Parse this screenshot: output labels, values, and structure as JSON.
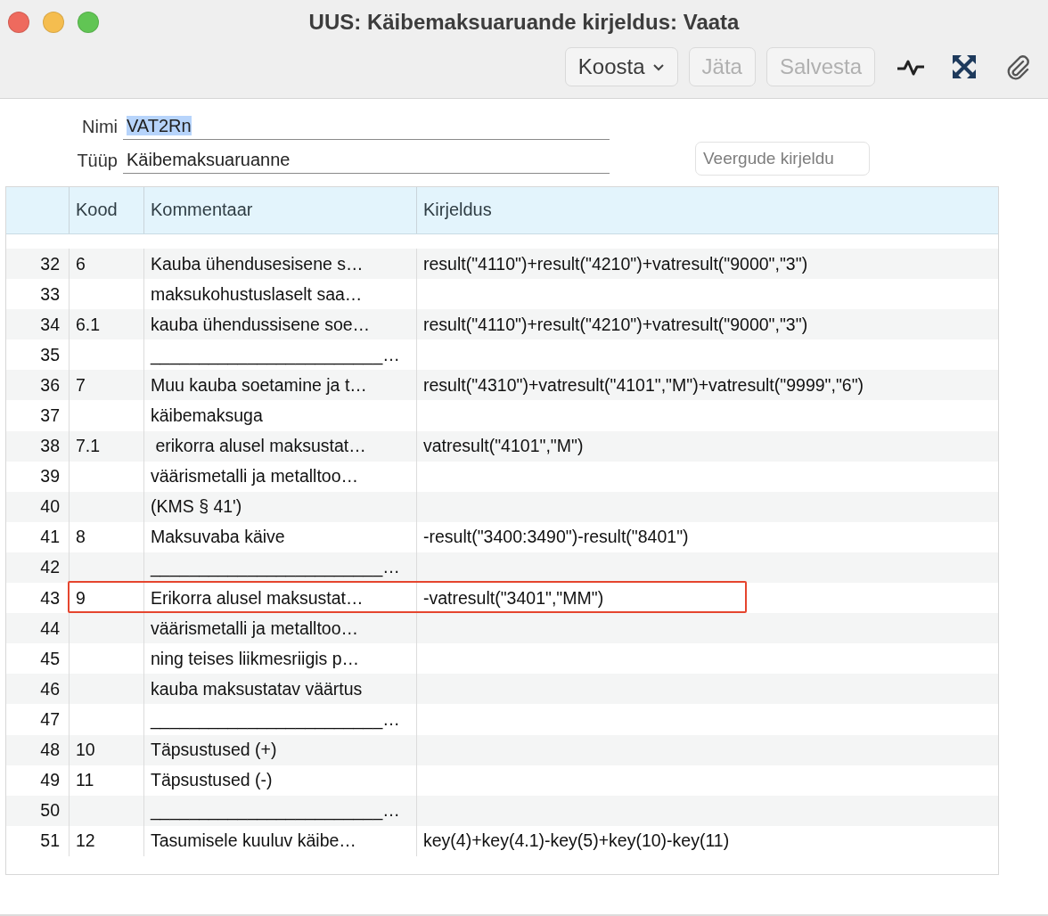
{
  "window": {
    "title": "UUS: Käibemaksuaruande kirjeldus: Vaata"
  },
  "toolbar": {
    "buttons": [
      {
        "label": "Koosta",
        "kind": "dropdown",
        "disabled": false
      },
      {
        "label": "Jäta",
        "kind": "plain",
        "disabled": true
      },
      {
        "label": "Salvesta",
        "kind": "plain",
        "disabled": true
      }
    ]
  },
  "form": {
    "fields": [
      {
        "label": "Nimi",
        "value": "VAT2Rn",
        "selected": true
      },
      {
        "label": "Tüüp",
        "value": "Käibemaksuaruanne",
        "selected": false
      }
    ],
    "side_button": {
      "label": "Veergude kirjeldu"
    }
  },
  "table": {
    "columns": [
      "",
      "Kood",
      "Kommentaar",
      "Kirjeldus"
    ],
    "rows": [
      {
        "n": "32",
        "kood": "6",
        "comment": "Kauba ühendusesisene s…",
        "formula": "result(\"4110\")+result(\"4210\")+vatresult(\"9000\",\"3\")",
        "highlighted": false
      },
      {
        "n": "33",
        "kood": "",
        "comment": "maksukohustuslaselt saa…",
        "formula": "",
        "highlighted": false
      },
      {
        "n": "34",
        "kood": "6.1",
        "comment": "kauba ühendussisene soe…",
        "formula": "result(\"4110\")+result(\"4210\")+vatresult(\"9000\",\"3\")",
        "highlighted": false
      },
      {
        "n": "35",
        "kood": "",
        "comment": "________________________…",
        "formula": "",
        "highlighted": false
      },
      {
        "n": "36",
        "kood": "7",
        "comment": "Muu kauba soetamine ja t…",
        "formula": "result(\"4310\")+vatresult(\"4101\",\"M\")+vatresult(\"9999\",\"6\")",
        "highlighted": false
      },
      {
        "n": "37",
        "kood": "",
        "comment": "käibemaksuga",
        "formula": "",
        "highlighted": false
      },
      {
        "n": "38",
        "kood": "7.1",
        "comment": " erikorra alusel maksustat…",
        "formula": "vatresult(\"4101\",\"M\")",
        "highlighted": false
      },
      {
        "n": "39",
        "kood": "",
        "comment": "väärismetalli ja metalltoo…",
        "formula": "",
        "highlighted": false
      },
      {
        "n": "40",
        "kood": "",
        "comment": "(KMS § 41')",
        "formula": "",
        "highlighted": false
      },
      {
        "n": "41",
        "kood": "8",
        "comment": "Maksuvaba käive",
        "formula": "-result(\"3400:3490\")-result(\"8401\")",
        "highlighted": false
      },
      {
        "n": "42",
        "kood": "",
        "comment": "________________________…",
        "formula": "",
        "highlighted": false
      },
      {
        "n": "43",
        "kood": "9",
        "comment": "Erikorra alusel maksustat…",
        "formula": "-vatresult(\"3401\",\"MM\")",
        "highlighted": true
      },
      {
        "n": "44",
        "kood": "",
        "comment": "väärismetalli ja metalltoo…",
        "formula": "",
        "highlighted": false
      },
      {
        "n": "45",
        "kood": "",
        "comment": "ning teises liikmesriigis p…",
        "formula": "",
        "highlighted": false
      },
      {
        "n": "46",
        "kood": "",
        "comment": "kauba maksustatav väärtus",
        "formula": "",
        "highlighted": false
      },
      {
        "n": "47",
        "kood": "",
        "comment": "________________________…",
        "formula": "",
        "highlighted": false
      },
      {
        "n": "48",
        "kood": "10",
        "comment": "Täpsustused (+)",
        "formula": "",
        "highlighted": false
      },
      {
        "n": "49",
        "kood": "11",
        "comment": "Täpsustused (-)",
        "formula": "",
        "highlighted": false
      },
      {
        "n": "50",
        "kood": "",
        "comment": "________________________…",
        "formula": "",
        "highlighted": false
      },
      {
        "n": "51",
        "kood": "12",
        "comment": "Tasumisele kuuluv käibe…",
        "formula": "key(4)+key(4.1)-key(5)+key(10)-key(11)",
        "highlighted": false
      }
    ]
  }
}
